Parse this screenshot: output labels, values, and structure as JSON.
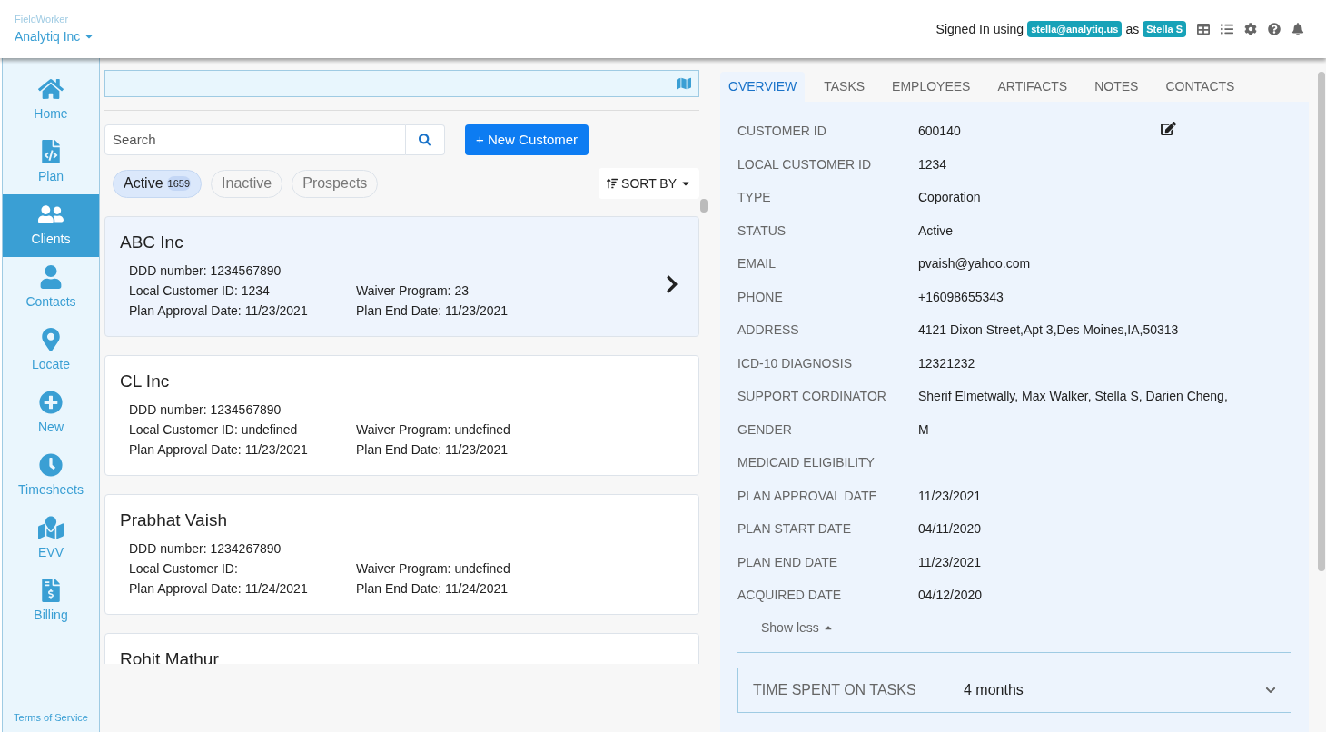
{
  "header": {
    "product": "FieldWorker",
    "org": "Analytiq Inc",
    "signed_in_label": "Signed In using",
    "email": "stella@analytiq.us",
    "as_label": "as",
    "user": "Stella S"
  },
  "sidebar": {
    "items": [
      {
        "label": "Home",
        "selected": false
      },
      {
        "label": "Plan",
        "selected": false
      },
      {
        "label": "Clients",
        "selected": true
      },
      {
        "label": "Contacts",
        "selected": false
      },
      {
        "label": "Locate",
        "selected": false
      },
      {
        "label": "New",
        "selected": false
      },
      {
        "label": "Timesheets",
        "selected": false
      },
      {
        "label": "EVV",
        "selected": false
      },
      {
        "label": "Billing",
        "selected": false
      }
    ],
    "footer_link": "Terms of Service"
  },
  "customers": {
    "search": {
      "placeholder": "Search"
    },
    "new_button": "+ New Customer",
    "filters": [
      {
        "label": "Active",
        "count": "1659",
        "selected": true
      },
      {
        "label": "Inactive",
        "selected": false
      },
      {
        "label": "Prospects",
        "selected": false
      }
    ],
    "sort": "SORT BY",
    "cards": [
      {
        "name": "ABC Inc",
        "ddd": "DDD number: 1234567890",
        "local_id": "Local Customer ID: 1234",
        "waiver": "Waiver Program: 23",
        "approval": "Plan Approval Date: 11/23/2021",
        "end": "Plan End Date: 11/23/2021",
        "selected": true
      },
      {
        "name": "CL Inc",
        "ddd": "DDD number: 1234567890",
        "local_id": "Local Customer ID: undefined",
        "waiver": "Waiver Program: undefined",
        "approval": "Plan Approval Date: 11/23/2021",
        "end": "Plan End Date: 11/23/2021",
        "selected": false
      },
      {
        "name": "Prabhat Vaish",
        "ddd": "DDD number: 1234267890",
        "local_id": "Local Customer ID:",
        "waiver": "Waiver Program: undefined",
        "approval": "Plan Approval Date: 11/24/2021",
        "end": "Plan End Date: 11/24/2021",
        "selected": false
      },
      {
        "name": "Rohit Mathur",
        "selected": false
      }
    ]
  },
  "detail": {
    "tabs": [
      {
        "label": "OVERVIEW",
        "selected": true
      },
      {
        "label": "TASKS",
        "selected": false
      },
      {
        "label": "EMPLOYEES",
        "selected": false
      },
      {
        "label": "ARTIFACTS",
        "selected": false
      },
      {
        "label": "NOTES",
        "selected": false
      },
      {
        "label": "CONTACTS",
        "selected": false
      }
    ],
    "fields": [
      {
        "label": "CUSTOMER ID",
        "value": "600140"
      },
      {
        "label": "LOCAL CUSTOMER ID",
        "value": "1234"
      },
      {
        "label": "TYPE",
        "value": "Coporation"
      },
      {
        "label": "STATUS",
        "value": "Active"
      },
      {
        "label": "EMAIL",
        "value": "pvaish@yahoo.com"
      },
      {
        "label": "PHONE",
        "value": "+16098655343"
      },
      {
        "label": "ADDRESS",
        "value": "4121 Dixon Street,Apt 3,Des Moines,IA,50313"
      },
      {
        "label": "ICD-10 DIAGNOSIS",
        "value": "12321232"
      },
      {
        "label": "SUPPORT CORDINATOR",
        "value": "Sherif Elmetwally, Max Walker, Stella S, Darien Cheng,"
      },
      {
        "label": "GENDER",
        "value": "M"
      },
      {
        "label": "MEDICAID ELIGIBILITY"
      },
      {
        "label": "PLAN APPROVAL DATE",
        "value": "11/23/2021"
      },
      {
        "label": "PLAN START DATE",
        "value": "04/11/2020"
      },
      {
        "label": "PLAN END DATE",
        "value": "11/23/2021"
      },
      {
        "label": "ACQUIRED DATE",
        "value": "04/12/2020"
      }
    ],
    "show_less": "Show less",
    "time_spent": {
      "label": "TIME SPENT ON TASKS",
      "value": "4 months"
    }
  }
}
